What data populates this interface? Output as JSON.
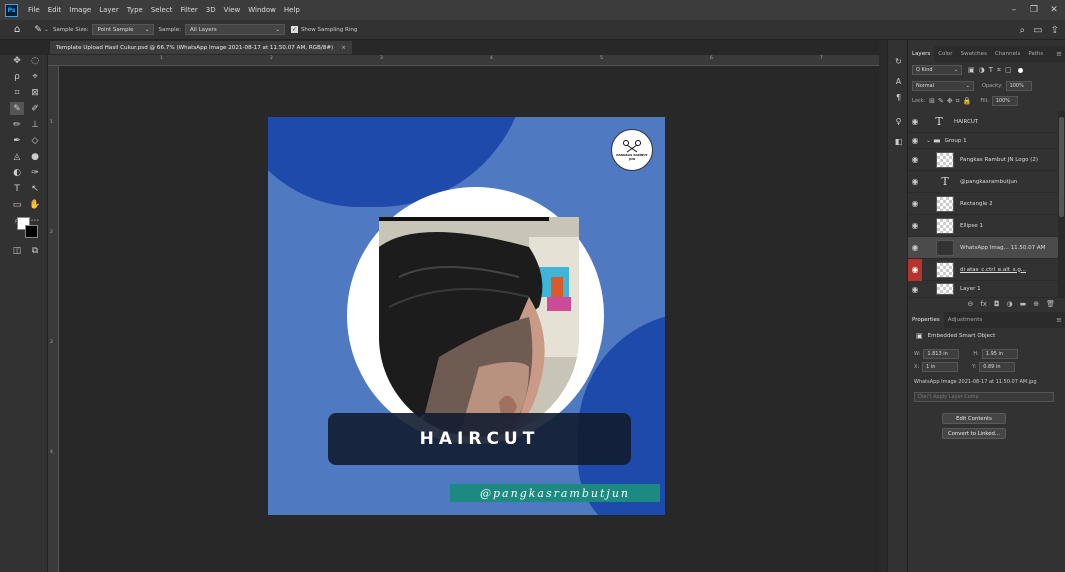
{
  "app": {
    "logo_text": "Ps"
  },
  "menu": [
    "File",
    "Edit",
    "Image",
    "Layer",
    "Type",
    "Select",
    "Filter",
    "3D",
    "View",
    "Window",
    "Help"
  ],
  "window_controls": {
    "minimize": "–",
    "restore": "❐",
    "close": "✕"
  },
  "options_bar": {
    "sample_size_label": "Sample Size:",
    "sample_size_value": "Point Sample",
    "sample_label": "Sample:",
    "sample_value": "All Layers",
    "show_ring_label": "Show Sampling Ring",
    "show_ring_checked": true
  },
  "document": {
    "tab_title": "Template Upload Hasil Cukur.psd @ 66.7% (WhatsApp Image 2021-08-17 at 11.50.07 AM, RGB/8#)",
    "tab_close": "×"
  },
  "ruler": {
    "h_ticks": [
      "1",
      "2",
      "3",
      "4",
      "5",
      "6",
      "7",
      "8"
    ],
    "v_ticks": [
      "1",
      "2",
      "3",
      "4"
    ]
  },
  "canvas": {
    "banner_text": "HAIRCUT",
    "handle_text": "@pangkasrambutjun",
    "logo_top": "PANGKAS RAMBUT",
    "logo_bottom": "JUN",
    "colors": {
      "bg": "#4f79c0",
      "dark_blob": "#1e4bab",
      "banner": "#121c30",
      "handle": "#1c8a80"
    }
  },
  "layers_panel": {
    "tabs": [
      "Layers",
      "Color",
      "Swatches",
      "Channels",
      "Paths"
    ],
    "filter_label": "Q Kind",
    "blend_mode": "Normal",
    "opacity_label": "Opacity:",
    "opacity_value": "100%",
    "lock_label": "Lock:",
    "fill_label": "Fill:",
    "fill_value": "100%",
    "layers": [
      {
        "name": "HAIRCUT",
        "kind": "text",
        "visible": true,
        "selected": false
      },
      {
        "name": "Group 1",
        "kind": "group",
        "visible": true,
        "selected": false
      },
      {
        "name": "Pangkas Rambut JN Logo (2)",
        "kind": "image",
        "visible": true,
        "selected": false
      },
      {
        "name": "@pangkasrambutjun",
        "kind": "text",
        "visible": true,
        "selected": false
      },
      {
        "name": "Rectangle 2",
        "kind": "shape",
        "visible": true,
        "selected": false
      },
      {
        "name": "Ellipse 1",
        "kind": "shape",
        "visible": true,
        "selected": false
      },
      {
        "name": "WhatsApp Imag... 11.50.07 AM",
        "kind": "smart",
        "visible": true,
        "selected": true
      },
      {
        "name": "di atas_c.ctrl_e.alt_s.g...",
        "kind": "image",
        "visible": true,
        "red_eye": true,
        "selected": false
      },
      {
        "name": "Layer 1",
        "kind": "image",
        "visible": true,
        "selected": false
      }
    ]
  },
  "properties_panel": {
    "tabs": [
      "Properties",
      "Adjustments"
    ],
    "object_type": "Embedded Smart Object",
    "w_label": "W:",
    "w_value": "1.813 in",
    "h_label": "H:",
    "h_value": "1.95 in",
    "x_label": "X:",
    "x_value": "1 in",
    "y_label": "Y:",
    "y_value": "0.89 in",
    "filename": "WhatsApp Image 2021-08-17 at 11.50.07 AM.jpg",
    "layer_comp_placeholder": "Don't Apply Layer Comp",
    "edit_contents": "Edit Contents",
    "convert_linked": "Convert to Linked..."
  }
}
